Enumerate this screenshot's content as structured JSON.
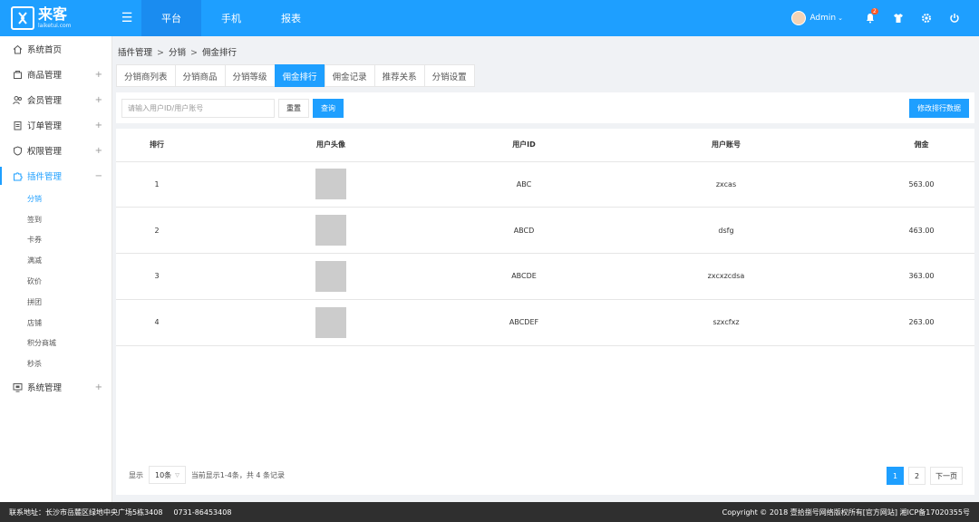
{
  "header": {
    "logo_main": "来客",
    "logo_sub": "laiketui.com",
    "nav": [
      {
        "label": "平台",
        "active": true
      },
      {
        "label": "手机",
        "active": false
      },
      {
        "label": "报表",
        "active": false
      }
    ],
    "admin_name": "Admin",
    "notification_count": "2"
  },
  "sidebar": {
    "items": [
      {
        "label": "系统首页",
        "icon": "home-icon"
      },
      {
        "label": "商品管理",
        "icon": "box-icon"
      },
      {
        "label": "会员管理",
        "icon": "users-icon"
      },
      {
        "label": "订单管理",
        "icon": "clipboard-icon"
      },
      {
        "label": "权限管理",
        "icon": "shield-icon"
      },
      {
        "label": "插件管理",
        "icon": "puzzle-icon"
      }
    ],
    "sub_items": [
      "分销",
      "签到",
      "卡券",
      "满减",
      "砍价",
      "拼团",
      "店铺",
      "积分商城",
      "秒杀"
    ],
    "last_item": {
      "label": "系统管理",
      "icon": "monitor-icon"
    },
    "plus": "+",
    "minus": "−"
  },
  "breadcrumb": [
    "插件管理",
    "分销",
    "佣金排行"
  ],
  "breadcrumb_sep": ">",
  "tabs": [
    {
      "label": "分销商列表",
      "active": false
    },
    {
      "label": "分销商品",
      "active": false
    },
    {
      "label": "分销等级",
      "active": false
    },
    {
      "label": "佣金排行",
      "active": true
    },
    {
      "label": "佣金记录",
      "active": false
    },
    {
      "label": "推荐关系",
      "active": false
    },
    {
      "label": "分销设置",
      "active": false
    }
  ],
  "toolbar": {
    "search_placeholder": "请输入用户ID/用户账号",
    "reset_label": "重置",
    "query_label": "查询",
    "modify_label": "修改排行数据"
  },
  "table": {
    "columns": [
      "排行",
      "用户头像",
      "用户ID",
      "用户账号",
      "佣金"
    ],
    "rows": [
      {
        "rank": "1",
        "user_id": "ABC",
        "account": "zxcas",
        "commission": "563.00"
      },
      {
        "rank": "2",
        "user_id": "ABCD",
        "account": "dsfg",
        "commission": "463.00"
      },
      {
        "rank": "3",
        "user_id": "ABCDE",
        "account": "zxcxzcdsa",
        "commission": "363.00"
      },
      {
        "rank": "4",
        "user_id": "ABCDEF",
        "account": "szxcfxz",
        "commission": "263.00"
      }
    ]
  },
  "pagination": {
    "show_label": "显示",
    "page_size": "10条",
    "summary": "当前显示1-4条，共 4 条记录",
    "pages": [
      {
        "label": "1",
        "active": true
      },
      {
        "label": "2",
        "active": false
      }
    ],
    "next_label": "下一页"
  },
  "footer": {
    "address": "联系地址：长沙市岳麓区绿地中央广场5栋3408",
    "phone": "0731-86453408",
    "copyright": "Copyright © 2018 壹拾捌号网络版权所有[官方网站]  湘ICP备17020355号"
  }
}
